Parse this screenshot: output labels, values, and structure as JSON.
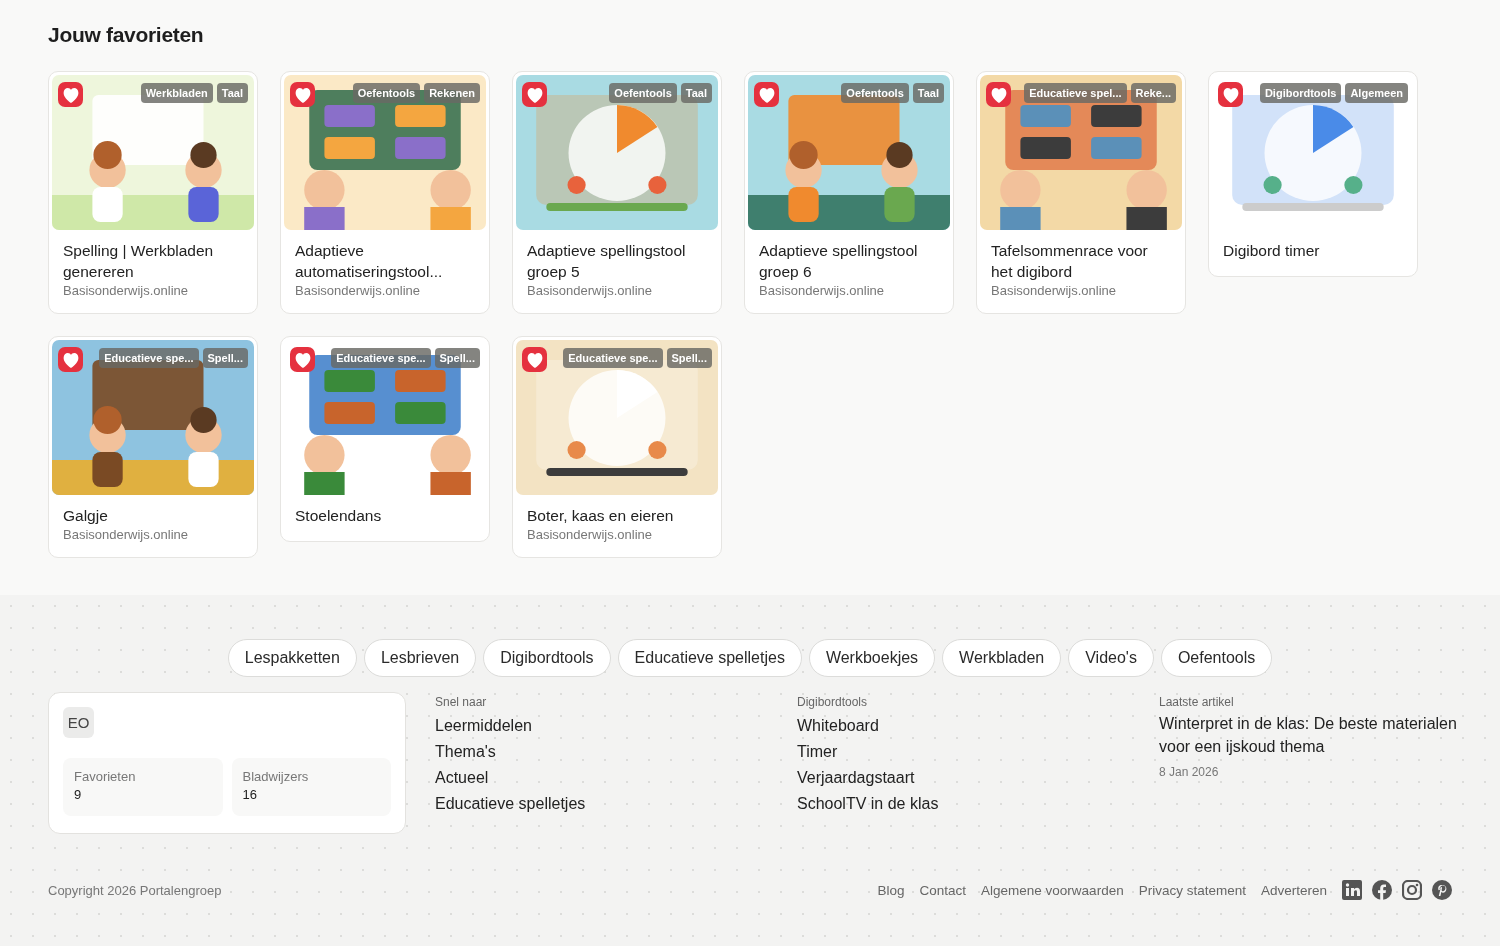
{
  "heading": "Jouw favorieten",
  "cards": [
    {
      "title": "Spelling | Werkbladen genereren",
      "source": "Basisonderwijs.online",
      "favorite": true,
      "tags": [
        "Werkbladen",
        "Taal"
      ]
    },
    {
      "title": "Adaptieve automatiseringstool...",
      "source": "Basisonderwijs.online",
      "favorite": true,
      "tags": [
        "Oefentools",
        "Rekenen"
      ]
    },
    {
      "title": "Adaptieve spellingstool groep 5",
      "source": "Basisonderwijs.online",
      "favorite": true,
      "tags": [
        "Oefentools",
        "Taal"
      ]
    },
    {
      "title": "Adaptieve spellingstool groep 6",
      "source": "Basisonderwijs.online",
      "favorite": true,
      "tags": [
        "Oefentools",
        "Taal"
      ]
    },
    {
      "title": "Tafelsommenrace voor het digibord",
      "source": "Basisonderwijs.online",
      "favorite": true,
      "tags": [
        "Educatieve spel...",
        "Reke..."
      ]
    },
    {
      "title": "Digibord timer",
      "favorite": true,
      "tags": [
        "Digibordtools",
        "Algemeen"
      ]
    },
    {
      "title": "Galgje",
      "source": "Basisonderwijs.online",
      "favorite": true,
      "tags": [
        "Educatieve spe...",
        "Spell..."
      ]
    },
    {
      "title": "Stoelendans",
      "favorite": true,
      "tags": [
        "Educatieve spe...",
        "Spell..."
      ]
    },
    {
      "title": "Boter, kaas en eieren",
      "source": "Basisonderwijs.online",
      "favorite": true,
      "tags": [
        "Educatieve spe...",
        "Spell..."
      ]
    }
  ],
  "footer": {
    "pills": [
      "Lespakketten",
      "Lesbrieven",
      "Digibordtools",
      "Educatieve spelletjes",
      "Werkboekjes",
      "Werkbladen",
      "Video's",
      "Oefentools"
    ],
    "profile": {
      "initials": "EO",
      "stats": [
        {
          "label": "Favorieten",
          "value": "9"
        },
        {
          "label": "Bladwijzers",
          "value": "16"
        }
      ]
    },
    "columns": [
      {
        "heading": "Snel naar",
        "links": [
          "Leermiddelen",
          "Thema's",
          "Actueel",
          "Educatieve spelletjes"
        ]
      },
      {
        "heading": "Digibordtools",
        "links": [
          "Whiteboard",
          "Timer",
          "Verjaardagstaart",
          "SchoolTV in de klas"
        ]
      }
    ],
    "article": {
      "heading": "Laatste artikel",
      "title": "Winterpret in de klas: De beste materialen voor een ijskoud thema",
      "date": "8 Jan 2026"
    },
    "copyright": "Copyright 2026 Portalengroep",
    "links": [
      "Blog",
      "Contact",
      "Algemene voorwaarden",
      "Privacy statement",
      "Adverteren"
    ],
    "socials": [
      {
        "kind": "linkedin"
      },
      {
        "kind": "facebook"
      },
      {
        "kind": "instagram"
      },
      {
        "kind": "pinterest"
      }
    ]
  }
}
